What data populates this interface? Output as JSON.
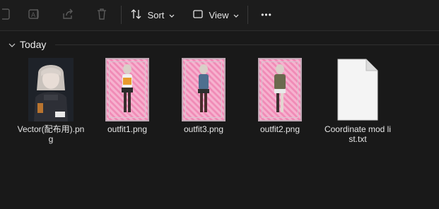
{
  "toolbar": {
    "sort_label": "Sort",
    "view_label": "View",
    "more_label": "•••"
  },
  "group": {
    "label": "Today"
  },
  "files": [
    {
      "name": "Vector(配布用).png",
      "type": "dark-vector"
    },
    {
      "name": "outfit1.png",
      "type": "pink-outfit"
    },
    {
      "name": "outfit3.png",
      "type": "pink-outfit"
    },
    {
      "name": "outfit2.png",
      "type": "pink-outfit"
    },
    {
      "name": "Coordinate mod list.txt",
      "type": "text-document"
    }
  ],
  "colors": {
    "background": "#191919",
    "toolbar": "#1c1c1c",
    "disabled_icon": "#5a5a5a",
    "thumb_pink": "#f08cb7"
  },
  "icons": {
    "new": "new-item-icon",
    "rename": "rename-icon",
    "share": "share-icon",
    "delete": "trash-icon",
    "sort": "sort-icon",
    "view": "view-icon",
    "group_toggle": "chevron-down-icon"
  }
}
